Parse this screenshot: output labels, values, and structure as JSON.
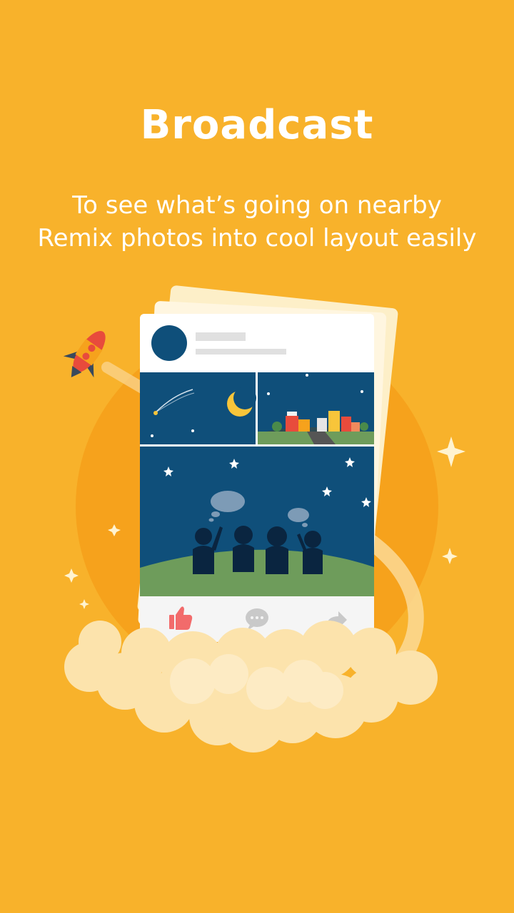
{
  "onboarding": {
    "title": "Broadcast",
    "subtitle_line1": "To see what’s going on nearby",
    "subtitle_line2": "Remix photos into cool layout easily"
  },
  "colors": {
    "background": "#F8B22B",
    "sun": "#F6A21C",
    "card": "#FFFFFF",
    "night_sky": "#0F4F7A",
    "grass": "#6E9C5B",
    "cloud": "#FCE3AC",
    "like": "#F26B6B",
    "icon_gray": "#C9C9C9"
  },
  "icons": {
    "rocket": "rocket-icon",
    "moon": "moon-icon",
    "like": "thumbs-up-icon",
    "comment": "speech-bubble-icon",
    "share": "share-arrow-icon",
    "sparkle": "sparkle-icon"
  }
}
